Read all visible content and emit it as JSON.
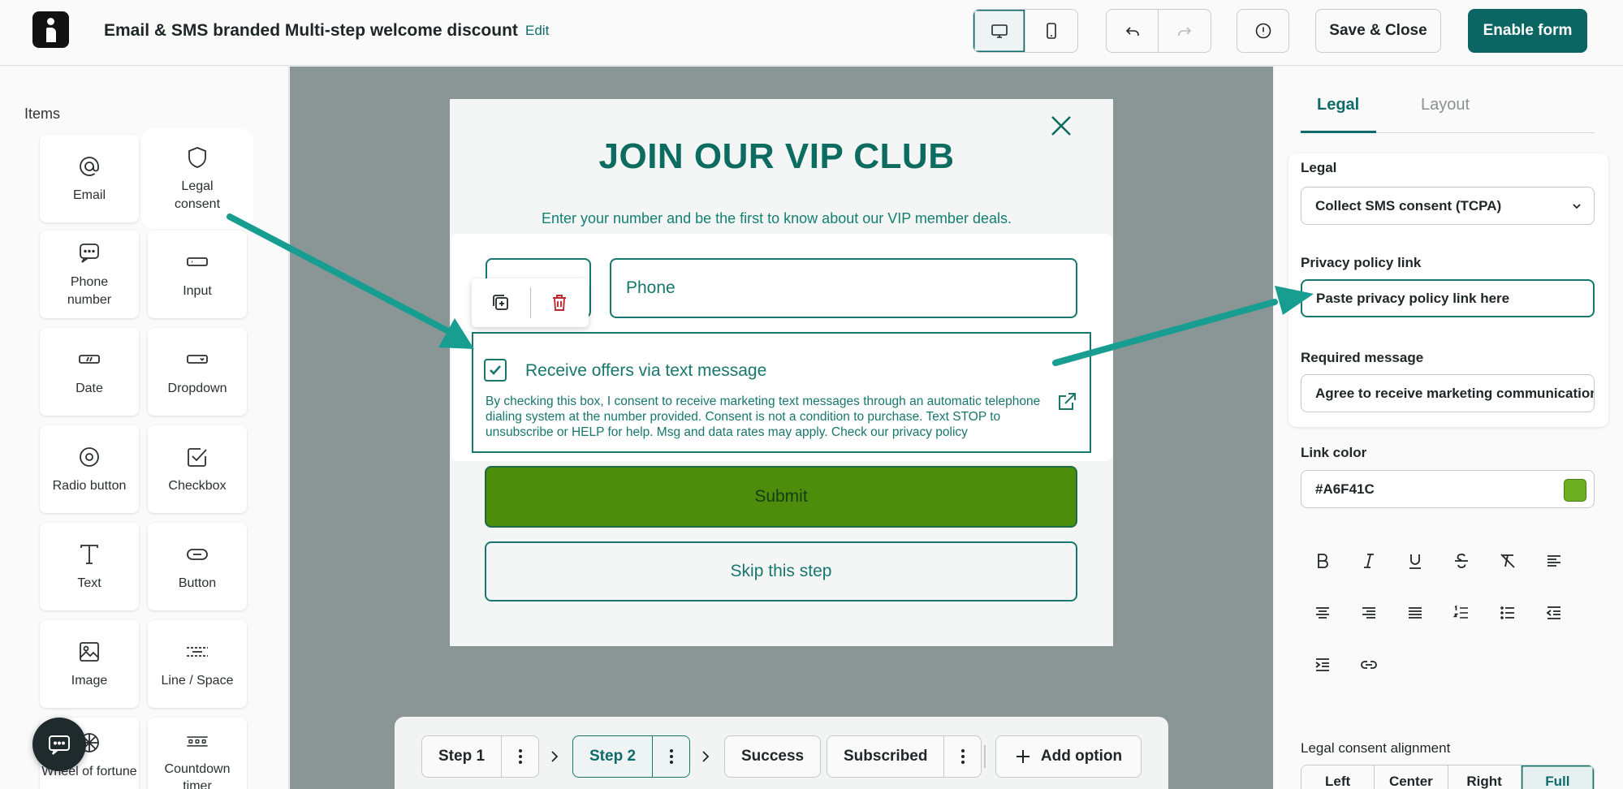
{
  "header": {
    "title": "Email & SMS branded Multi-step welcome discount",
    "edit_label": "Edit",
    "save_close_label": "Save & Close",
    "enable_label": "Enable form"
  },
  "items_panel": {
    "title": "Items",
    "items": [
      {
        "label": "Email",
        "icon": "at-icon"
      },
      {
        "label": "Legal consent",
        "icon": "shield-icon"
      },
      {
        "label": "Phone number",
        "icon": "phone-message-icon"
      },
      {
        "label": "Input",
        "icon": "input-icon"
      },
      {
        "label": "Date",
        "icon": "date-icon"
      },
      {
        "label": "Dropdown",
        "icon": "dropdown-icon"
      },
      {
        "label": "Radio button",
        "icon": "radio-icon"
      },
      {
        "label": "Checkbox",
        "icon": "checkbox-icon"
      },
      {
        "label": "Text",
        "icon": "text-icon"
      },
      {
        "label": "Button",
        "icon": "button-icon"
      },
      {
        "label": "Image",
        "icon": "image-icon"
      },
      {
        "label": "Line / Space",
        "icon": "line-space-icon"
      },
      {
        "label": "Wheel of fortune",
        "icon": "wheel-icon"
      },
      {
        "label": "Countdown timer",
        "icon": "countdown-icon"
      }
    ]
  },
  "popup": {
    "title": "JOIN OUR VIP CLUB",
    "subtitle": "Enter your number and be the first to know about our VIP member deals.",
    "phone_placeholder": "Phone",
    "consent_label": "Receive offers via text message",
    "consent_text": "By checking this box, I consent to receive marketing text messages through an automatic telephone dialing system at the number provided. Consent is not a condition to purchase. Text STOP to unsubscribe or HELP for help. Msg and data rates may apply. Check our privacy policy",
    "submit_label": "Submit",
    "skip_label": "Skip this step"
  },
  "steps": {
    "items": [
      "Step 1",
      "Step 2",
      "Success",
      "Subscribed"
    ],
    "add_label": "Add option"
  },
  "settings": {
    "tabs": [
      "Legal",
      "Layout"
    ],
    "legal_label": "Legal",
    "legal_value": "Collect SMS consent (TCPA)",
    "privacy_label": "Privacy policy link",
    "privacy_value": "Paste privacy policy link here",
    "required_label": "Required message",
    "required_value": "Agree to receive marketing communications",
    "link_color_label": "Link color",
    "link_color_value": "#A6F41C",
    "alignment_label": "Legal consent alignment",
    "alignment_options": [
      "Left",
      "Center",
      "Right",
      "Full"
    ]
  },
  "colors": {
    "brand": "#0b6563",
    "popup_text": "#17776c",
    "submit": "#4e8c0c",
    "arrow": "#179e91",
    "swatch": "#6cb022"
  }
}
